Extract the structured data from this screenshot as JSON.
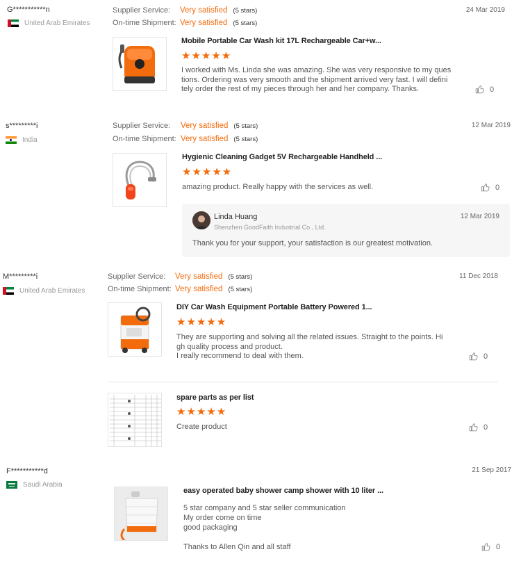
{
  "labels": {
    "supplier_service": "Supplier Service:",
    "ontime_shipment": "On-time Shipment:"
  },
  "colors": {
    "accent": "#f26c0d",
    "text": "#333333",
    "muted": "#999999"
  },
  "reviews": [
    {
      "user": "G***********n",
      "country": "United Arab Emirates",
      "flag_icon": "uae-flag-icon",
      "date": "24 Mar 2019",
      "supplier_service_value": "Very satisfied",
      "supplier_service_stars": "(5 stars)",
      "ontime_value": "Very satisfied",
      "ontime_stars": "(5 stars)",
      "items": [
        {
          "title": "Mobile Portable Car Wash kit 17L Rechargeable Car+w...",
          "stars": "★★★★★",
          "text": [
            "I worked with Ms. Linda she was amazing. She was very responsive to my ques",
            "tions. Ordering was very smooth and the shipment arrived very fast. I will defini",
            "tely order the rest of my pieces through her and her company. Thanks."
          ],
          "likes": "0"
        }
      ]
    },
    {
      "user": "s*********i",
      "country": "India",
      "flag_icon": "india-flag-icon",
      "date": "12 Mar 2019",
      "supplier_service_value": "Very satisfied",
      "supplier_service_stars": "(5 stars)",
      "ontime_value": "Very satisfied",
      "ontime_stars": "(5 stars)",
      "items": [
        {
          "title": "Hygienic Cleaning Gadget 5V Rechargeable Handheld ...",
          "stars": "★★★★★",
          "text": [
            "amazing product. Really happy with the services as well."
          ],
          "likes": "0"
        }
      ],
      "reply": {
        "name": "Linda Huang",
        "company": "Shenzhen GoodFaith Industrial Co., Ltd.",
        "date": "12 Mar 2019",
        "text": "Thank you for your support,  your satisfaction is our greatest motivation."
      }
    },
    {
      "user": "M*********i",
      "country": "United Arab Emirates",
      "flag_icon": "uae-flag-icon",
      "date": "11 Dec 2018",
      "supplier_service_value": "Very satisfied",
      "supplier_service_stars": "(5 stars)",
      "ontime_value": "Very satisfied",
      "ontime_stars": "(5 stars)",
      "items": [
        {
          "title": "DIY Car Wash Equipment Portable Battery Powered 1...",
          "stars": "★★★★★",
          "text": [
            "They are supporting and solving all the related issues. Straight to the points. Hi",
            "gh quality process and product.",
            "I really recommend to deal with them."
          ],
          "likes": "0"
        },
        {
          "title": "spare parts as per list",
          "stars": "★★★★★",
          "text": [
            "Create product"
          ],
          "likes": "0"
        }
      ]
    },
    {
      "user": "F***********d",
      "country": "Saudi Arabia",
      "flag_icon": "saudi-flag-icon",
      "date": "21 Sep 2017",
      "items": [
        {
          "title": "easy operated baby shower camp shower with 10 liter ...",
          "text": [
            "5 star company and 5 star seller communication",
            "My order come on time",
            "good packaging",
            "",
            "Thanks to Allen Qin and all staff"
          ],
          "likes": "0"
        }
      ]
    }
  ]
}
